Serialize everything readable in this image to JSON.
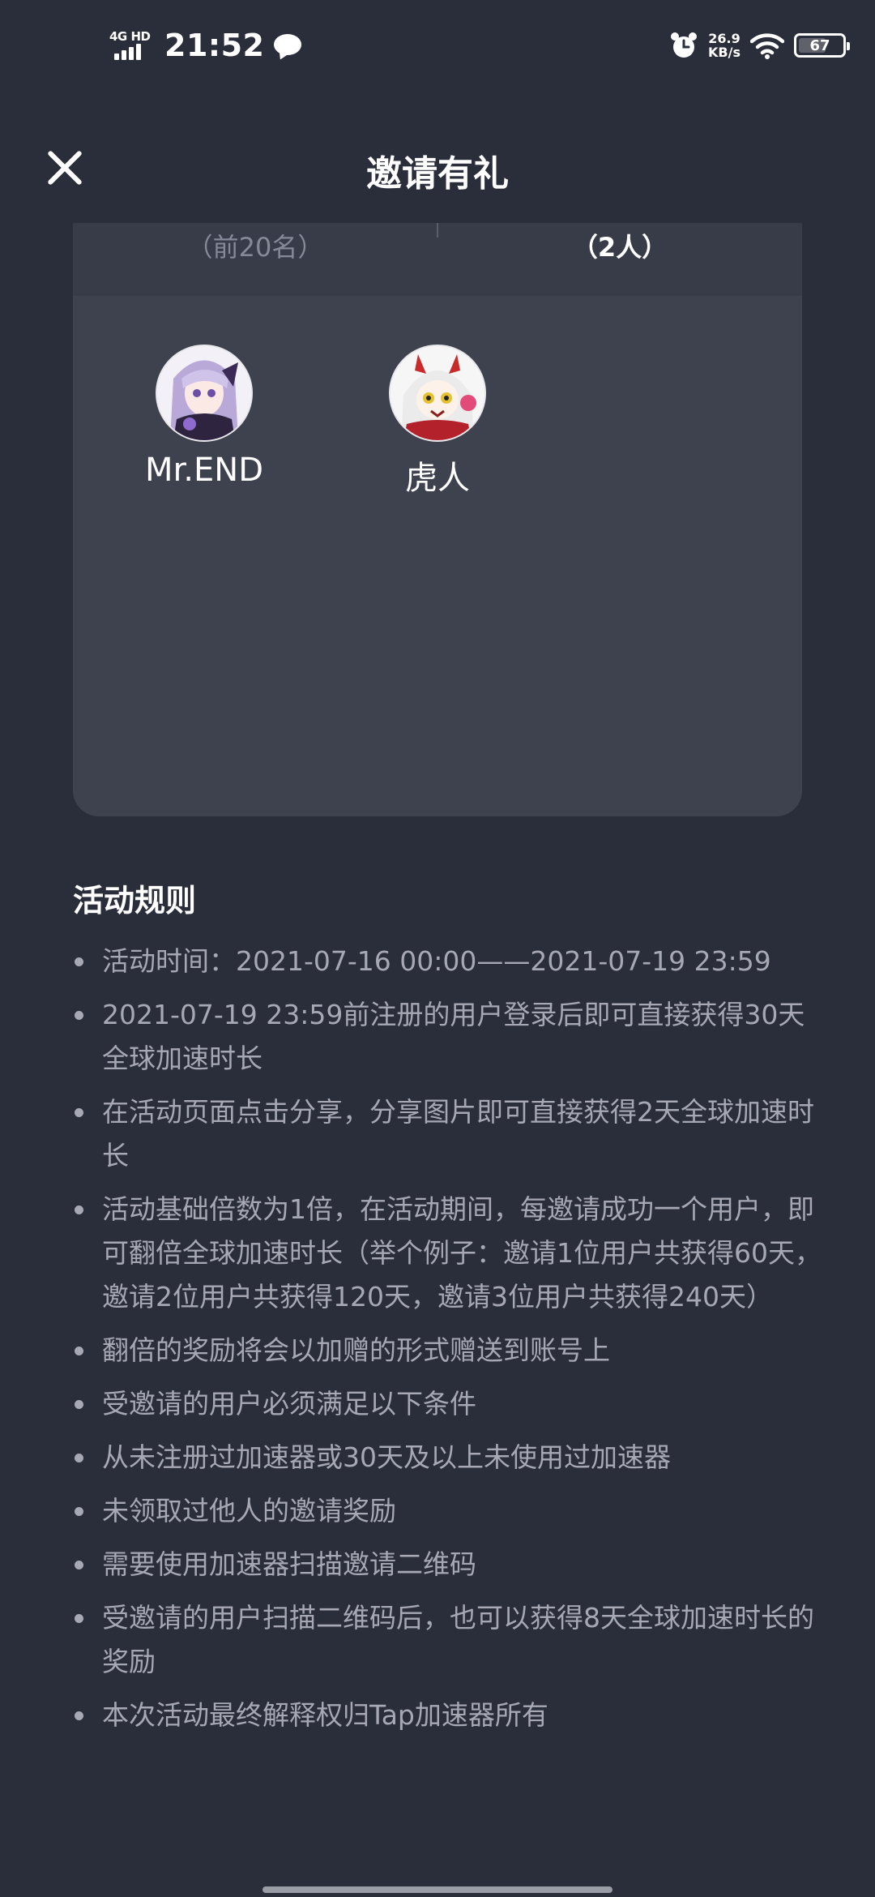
{
  "status_bar": {
    "network": "4G HD",
    "time": "21:52",
    "speed_value": "26.9",
    "speed_unit": "KB/s",
    "battery": "67",
    "battery_level": 0.67,
    "icons": [
      "signal-icon",
      "chat-bubble-icon",
      "alarm-icon",
      "wifi-icon",
      "battery-icon"
    ]
  },
  "navbar": {
    "title": "邀请有礼",
    "close_icon": "close-icon"
  },
  "card": {
    "tab_left": "（前20名）",
    "tab_right": "（2人）",
    "users": [
      {
        "name": "Mr.END"
      },
      {
        "name": "虎人"
      }
    ]
  },
  "rules": {
    "title": "活动规则",
    "items": [
      "活动时间：2021-07-16 00:00——2021-07-19 23:59",
      "2021-07-19 23:59前注册的用户登录后即可直接获得30天全球加速时长",
      "在活动页面点击分享，分享图片即可直接获得2天全球加速时长",
      "活动基础倍数为1倍，在活动期间，每邀请成功一个用户，即可翻倍全球加速时长（举个例子：邀请1位用户共获得60天，邀请2位用户共获得120天，邀请3位用户共获得240天）",
      "翻倍的奖励将会以加赠的形式赠送到账号上",
      "受邀请的用户必须满足以下条件",
      "从未注册过加速器或30天及以上未使用过加速器",
      "未领取过他人的邀请奖励",
      "需要使用加速器扫描邀请二维码",
      "受邀请的用户扫描二维码后，也可以获得8天全球加速时长的奖励",
      "本次活动最终解释权归Tap加速器所有"
    ]
  }
}
